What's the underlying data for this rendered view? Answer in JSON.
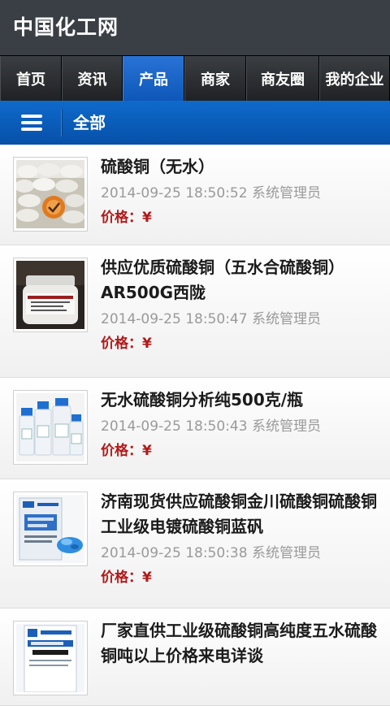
{
  "app": {
    "title": "中国化工网"
  },
  "tabs": [
    {
      "label": "首页"
    },
    {
      "label": "资讯"
    },
    {
      "label": "产品"
    },
    {
      "label": "商家"
    },
    {
      "label": "商友圈"
    },
    {
      "label": "我的企业"
    }
  ],
  "active_tab": "产品",
  "subheader": {
    "label": "全部",
    "menu_icon": "hamburger-menu-icon"
  },
  "colors": {
    "topbar": "#3a3f45",
    "tab_active": "#0d57b8",
    "subheader": "#0650a8",
    "price": "#b21a1a",
    "meta": "#9a9a9a"
  },
  "products": [
    {
      "title": "硫酸铜（无水）",
      "datetime": "2014-09-25 18:50:52",
      "author": "系统管理员",
      "price_label": "价格：¥",
      "thumb_icon": "stacked-sacks-image"
    },
    {
      "title": "供应优质硫酸铜（五水合硫酸铜）AR500G西陇",
      "datetime": "2014-09-25 18:50:47",
      "author": "系统管理员",
      "price_label": "价格：¥",
      "thumb_icon": "reagent-jar-image"
    },
    {
      "title": "无水硫酸铜分析纯500克/瓶",
      "datetime": "2014-09-25 18:50:43",
      "author": "系统管理员",
      "price_label": "价格：¥",
      "thumb_icon": "reagent-bottles-image"
    },
    {
      "title": "济南现货供应硫酸铜金川硫酸铜硫酸铜工业级电镀硫酸铜蓝矾",
      "datetime": "2014-09-25 18:50:38",
      "author": "系统管理员",
      "price_label": "价格：¥",
      "thumb_icon": "blue-crystal-bag-image"
    },
    {
      "title": "厂家直供工业级硫酸铜高纯度五水硫酸铜吨以上价格来电详谈",
      "datetime": "",
      "author": "",
      "price_label": "",
      "thumb_icon": "product-bag-label-image"
    }
  ]
}
